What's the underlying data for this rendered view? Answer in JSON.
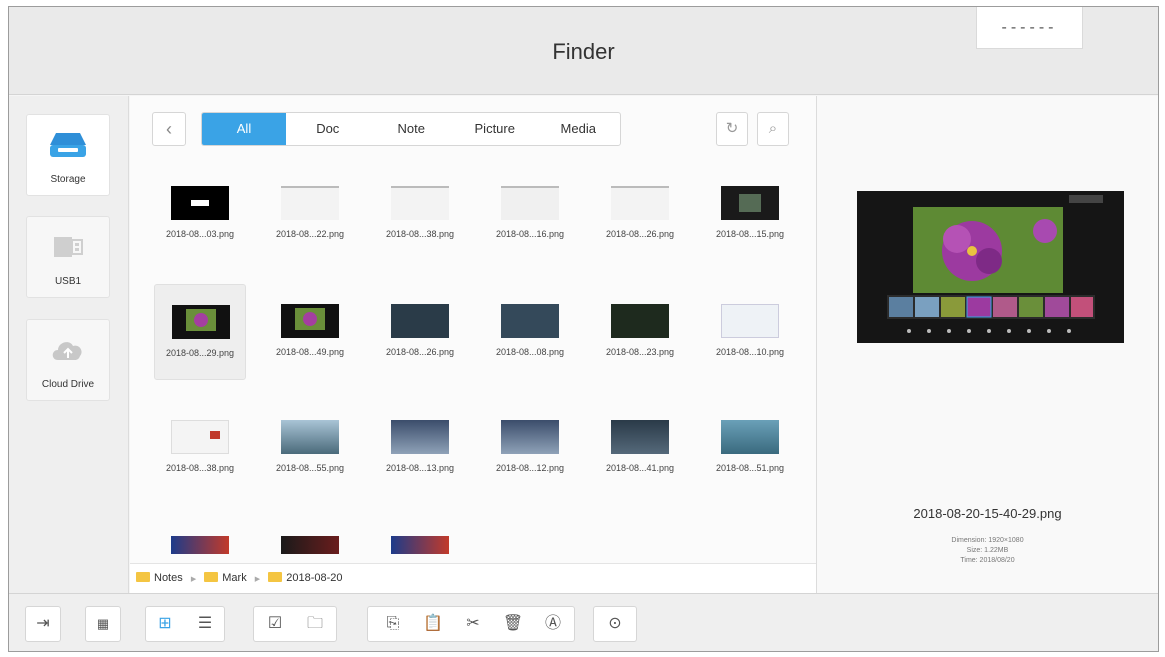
{
  "window": {
    "title": "Finder",
    "title_box_text": "------"
  },
  "sidebar": {
    "items": [
      {
        "label": "Storage",
        "icon": "storage-icon"
      },
      {
        "label": "USB1",
        "icon": "usb-icon"
      },
      {
        "label": "Cloud Drive",
        "icon": "cloud-upload-icon"
      }
    ]
  },
  "toolbar_top": {
    "back_icon": "chevron-left-icon",
    "tabs": [
      "All",
      "Doc",
      "Note",
      "Picture",
      "Media"
    ],
    "active_tab": "All",
    "refresh_icon": "refresh-icon",
    "search_icon": "search-icon"
  },
  "files": [
    {
      "name": "2018-08...03.png"
    },
    {
      "name": "2018-08...22.png"
    },
    {
      "name": "2018-08...38.png"
    },
    {
      "name": "2018-08...16.png"
    },
    {
      "name": "2018-08...26.png"
    },
    {
      "name": "2018-08...15.png"
    },
    {
      "name": "2018-08...29.png"
    },
    {
      "name": "2018-08...49.png"
    },
    {
      "name": "2018-08...26.png"
    },
    {
      "name": "2018-08...08.png"
    },
    {
      "name": "2018-08...23.png"
    },
    {
      "name": "2018-08...10.png"
    },
    {
      "name": "2018-08...38.png"
    },
    {
      "name": "2018-08...55.png"
    },
    {
      "name": "2018-08...13.png"
    },
    {
      "name": "2018-08...12.png"
    },
    {
      "name": "2018-08...41.png"
    },
    {
      "name": "2018-08...51.png"
    },
    {
      "name": ""
    },
    {
      "name": ""
    },
    {
      "name": ""
    }
  ],
  "selected_file_index": 6,
  "path": [
    "Notes",
    "Mark",
    "2018-08-20"
  ],
  "preview": {
    "filename": "2018-08-20-15-40-29.png",
    "dimension": "Dimension: 1920×1080",
    "size": "Size: 1.22MB",
    "time": "Time: 2018/08/20"
  },
  "bottom_toolbar": {
    "icons": [
      "exit-icon",
      "multi-window-icon",
      "grid-view-icon",
      "list-view-icon",
      "select-icon",
      "new-folder-icon",
      "copy-icon",
      "paste-icon",
      "cut-icon",
      "delete-icon",
      "rename-icon",
      "more-icon"
    ],
    "active_view": "grid"
  },
  "colors": {
    "accent": "#3aa3e6",
    "folder": "#f4c542"
  }
}
